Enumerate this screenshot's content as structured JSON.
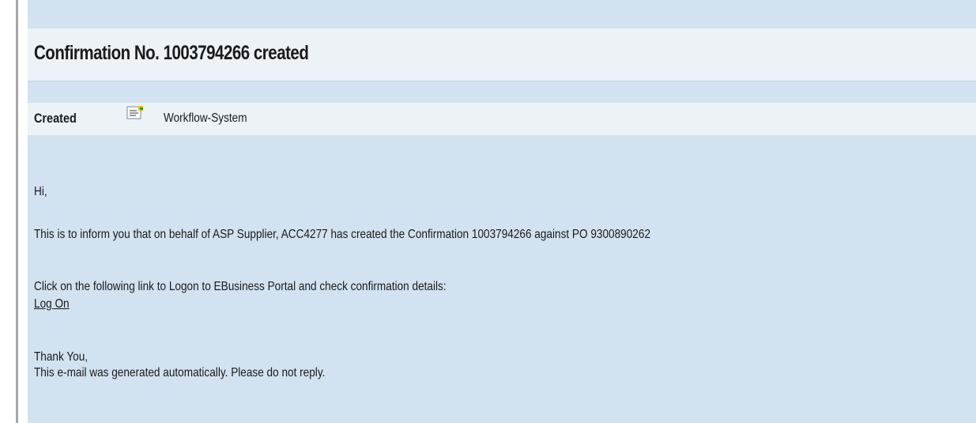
{
  "email": {
    "title": "Confirmation No. 1003794266 created",
    "meta": {
      "label": "Created",
      "icon": "document-icon",
      "sender": "Workflow-System"
    },
    "greeting": "Hi,",
    "message": "This is to inform you that on behalf of ASP Supplier, ACC4277 has created the Confirmation 1003794266 against PO 9300890262",
    "instruction": "Click on the following link to Logon to EBusiness Portal and check confirmation details:",
    "link_label": "Log On",
    "closing": "Thank You,",
    "footer": "This e-mail was generated automatically. Please do not reply."
  },
  "colors": {
    "panel_background": "#d3e2f0",
    "header_background": "#edf2f7",
    "left_border": "#a7a7a7"
  }
}
